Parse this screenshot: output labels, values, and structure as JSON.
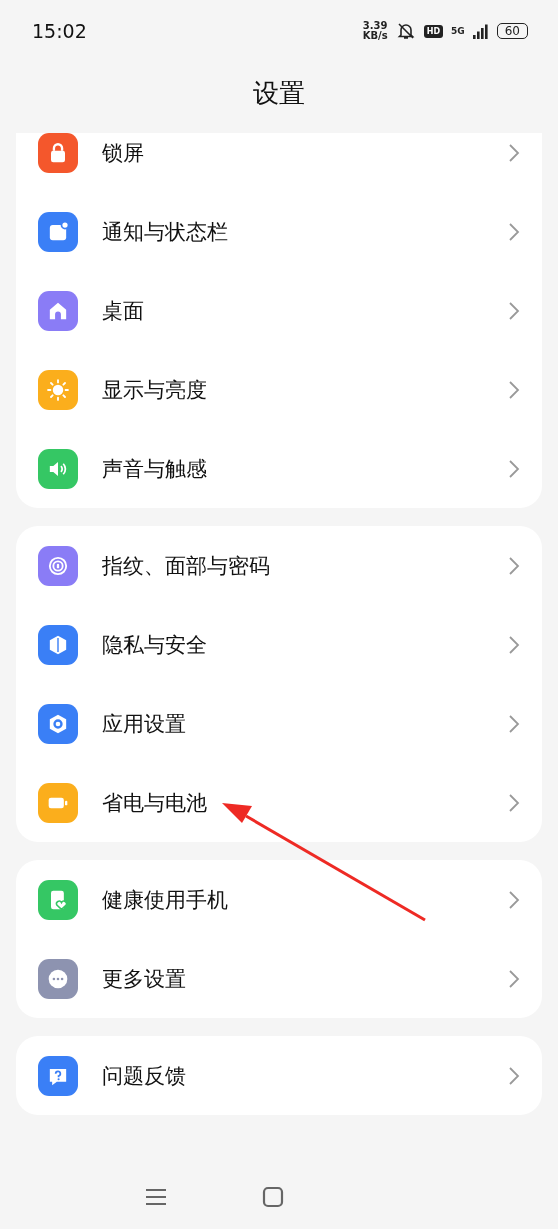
{
  "status_bar": {
    "time": "15:02",
    "net_speed_value": "3.39",
    "net_speed_unit": "KB/s",
    "hd": "HD",
    "network": "5G",
    "battery": "60"
  },
  "title": "设置",
  "groups": [
    {
      "items": [
        {
          "label": "锁屏",
          "kind": "lock",
          "color": "#f4572c"
        },
        {
          "label": "通知与状态栏",
          "kind": "notification",
          "color": "#3a7ff6"
        },
        {
          "label": "桌面",
          "kind": "home",
          "color": "#8a7cf6"
        },
        {
          "label": "显示与亮度",
          "kind": "sun",
          "color": "#fbae1c"
        },
        {
          "label": "声音与触感",
          "kind": "sound",
          "color": "#35c764"
        }
      ]
    },
    {
      "items": [
        {
          "label": "指纹、面部与密码",
          "kind": "fingerprint",
          "color": "#8a7cf6"
        },
        {
          "label": "隐私与安全",
          "kind": "privacy",
          "color": "#3a7ff6"
        },
        {
          "label": "应用设置",
          "kind": "apps",
          "color": "#3a7ff6"
        },
        {
          "label": "省电与电池",
          "kind": "battery",
          "color": "#fbae1c"
        }
      ]
    },
    {
      "items": [
        {
          "label": "健康使用手机",
          "kind": "health",
          "color": "#35c764"
        },
        {
          "label": "更多设置",
          "kind": "more",
          "color": "#8d93b0"
        }
      ]
    },
    {
      "items": [
        {
          "label": "问题反馈",
          "kind": "feedback",
          "color": "#3a7ff6"
        }
      ]
    }
  ]
}
